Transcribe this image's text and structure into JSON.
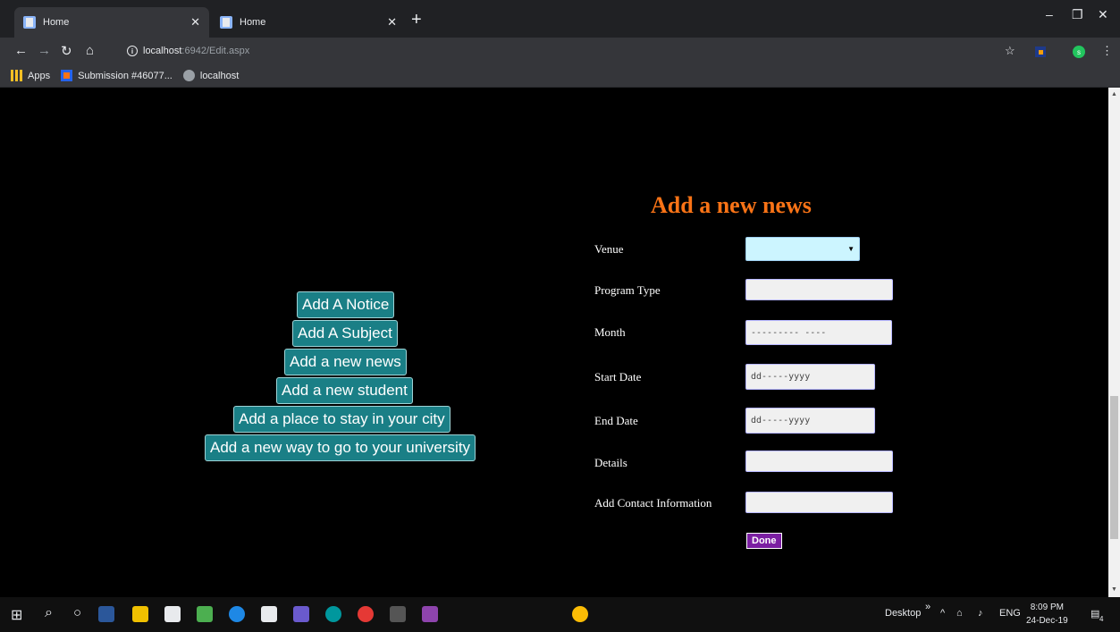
{
  "browser": {
    "tabs": [
      {
        "title": "Home"
      },
      {
        "title": "Home"
      }
    ],
    "url_host": "localhost",
    "url_rest": ":6942/Edit.aspx",
    "bookmarks": [
      "Apps",
      "Submission #46077...",
      "localhost"
    ],
    "profile_initial": "s"
  },
  "nav_buttons": [
    "Add A Notice",
    "Add A Subject",
    "Add a new news",
    "Add a new student",
    "Add a place to stay in your city",
    "Add a new way to go to your university"
  ],
  "form": {
    "title": "Add a new news",
    "venue_label": "Venue",
    "program_type_label": "Program Type",
    "month_label": "Month",
    "month_placeholder": "---------  ----",
    "start_date_label": "Start Date",
    "start_date_placeholder": "dd-----yyyy",
    "end_date_label": "End Date",
    "end_date_placeholder": "dd-----yyyy",
    "details_label": "Details",
    "contact_label": "Add Contact Information",
    "done_label": "Done"
  },
  "taskbar": {
    "desktop_label": "Desktop",
    "lang": "ENG",
    "time": "8:09 PM",
    "date": "24-Dec-19",
    "notification_count": "4"
  },
  "colors": {
    "accent_title": "#f97316",
    "nav_button_bg": "#1a7f86",
    "done_button_bg": "#7b1fa2",
    "venue_select_bg": "#ccf5ff"
  }
}
